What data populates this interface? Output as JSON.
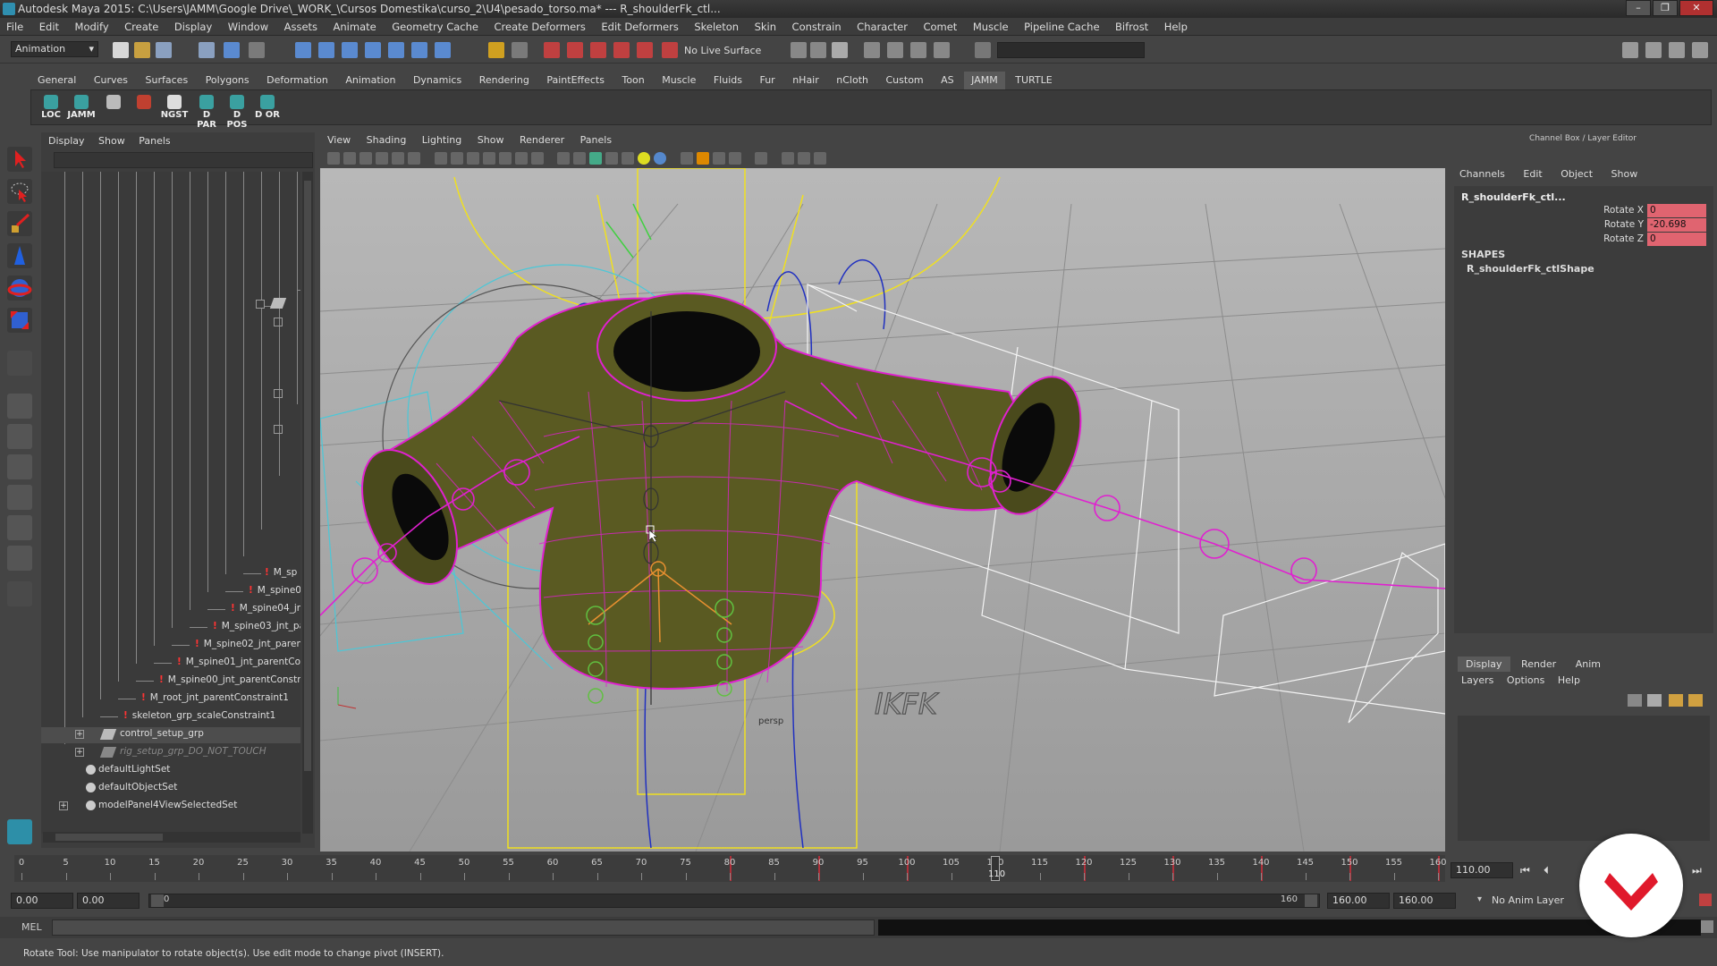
{
  "window": {
    "title": "Autodesk Maya 2015: C:\\Users\\JAMM\\Google Drive\\_WORK_\\Cursos Domestika\\curso_2\\U4\\pesado_torso.ma*   ---   R_shoulderFk_ctl...",
    "minimize": "–",
    "restore": "❐",
    "close": "✕"
  },
  "menubar": [
    "File",
    "Edit",
    "Modify",
    "Create",
    "Display",
    "Window",
    "Assets",
    "Animate",
    "Geometry Cache",
    "Create Deformers",
    "Edit Deformers",
    "Skeleton",
    "Skin",
    "Constrain",
    "Character",
    "Comet",
    "Muscle",
    "Pipeline Cache",
    "Bifrost",
    "Help"
  ],
  "statusline": {
    "mode": "Animation",
    "live_surface": "No Live Surface"
  },
  "shelf": {
    "tabs": [
      "General",
      "Curves",
      "Surfaces",
      "Polygons",
      "Deformation",
      "Animation",
      "Dynamics",
      "Rendering",
      "PaintEffects",
      "Toon",
      "Muscle",
      "Fluids",
      "Fur",
      "nHair",
      "nCloth",
      "Custom",
      "AS",
      "JAMM",
      "TURTLE"
    ],
    "active_tab": "JAMM",
    "buttons": [
      "LOC",
      "JAMM",
      "",
      "",
      "NGST",
      "D PAR",
      "D POS",
      "D OR"
    ]
  },
  "outliner": {
    "menu": [
      "Display",
      "Show",
      "Panels"
    ],
    "nodes": [
      {
        "label": "M_sp",
        "constraint": true
      },
      {
        "label": "M_spine0",
        "constraint": true
      },
      {
        "label": "M_spine04_jn",
        "constraint": true
      },
      {
        "label": "M_spine03_jnt_pa",
        "constraint": true
      },
      {
        "label": "M_spine02_jnt_paren",
        "constraint": true
      },
      {
        "label": "M_spine01_jnt_parentCor",
        "constraint": true
      },
      {
        "label": "M_spine00_jnt_parentConstra",
        "constraint": true
      },
      {
        "label": "M_root_jnt_parentConstraint1",
        "constraint": true
      },
      {
        "label": "skeleton_grp_scaleConstraint1",
        "constraint": true
      },
      {
        "label": "control_setup_grp",
        "constraint": false
      },
      {
        "label": "rig_setup_grp_DO_NOT_TOUCH",
        "constraint": false
      },
      {
        "label": "defaultLightSet",
        "constraint": false
      },
      {
        "label": "defaultObjectSet",
        "constraint": false
      },
      {
        "label": "modelPanel4ViewSelectedSet",
        "constraint": false
      }
    ]
  },
  "viewport": {
    "menu": [
      "View",
      "Shading",
      "Lighting",
      "Show",
      "Renderer",
      "Panels"
    ],
    "overlay_text": "IKFK",
    "camera_label": "persp"
  },
  "channelbox": {
    "title": "Channel Box / Layer Editor",
    "menu": [
      "Channels",
      "Edit",
      "Object",
      "Show"
    ],
    "object_name": "R_shoulderFk_ctl...",
    "attributes": [
      {
        "label": "Rotate X",
        "value": "0"
      },
      {
        "label": "Rotate Y",
        "value": "-20.698"
      },
      {
        "label": "Rotate Z",
        "value": "0"
      }
    ],
    "shapes_heading": "SHAPES",
    "shape_name": "R_shoulderFk_ctlShape"
  },
  "layer_editor": {
    "tabs": [
      "Display",
      "Render",
      "Anim"
    ],
    "active_tab": "Display",
    "menu": [
      "Layers",
      "Options",
      "Help"
    ]
  },
  "timeline": {
    "ticks": [
      0,
      5,
      10,
      15,
      20,
      25,
      30,
      35,
      40,
      45,
      50,
      55,
      60,
      65,
      70,
      75,
      80,
      85,
      90,
      95,
      100,
      105,
      110,
      115,
      120,
      125,
      130,
      135,
      140,
      145,
      150,
      155,
      160
    ],
    "keyframes": [
      80,
      90,
      100,
      110,
      120,
      130,
      140,
      150,
      160
    ],
    "current_frame": "110",
    "current_time_field": "110.00"
  },
  "range": {
    "start_time": "0.00",
    "playback_start": "0.00",
    "range_start_label": "0",
    "range_end_label": "160",
    "playback_end": "160.00",
    "end_time": "160.00",
    "anim_layer": "No Anim Layer"
  },
  "commandline": {
    "label": "MEL"
  },
  "helpline": {
    "text": "Rotate Tool: Use manipulator to rotate object(s). Use edit mode to change pivot (INSERT)."
  },
  "colors": {
    "wire_magenta": "#e020d0",
    "mesh_olive": "#5a5a22",
    "yellow_ctrl": "#f0e020",
    "blue_ctrl": "#2030c0",
    "key_red": "#b0303a",
    "badge_red": "#e0192b"
  }
}
